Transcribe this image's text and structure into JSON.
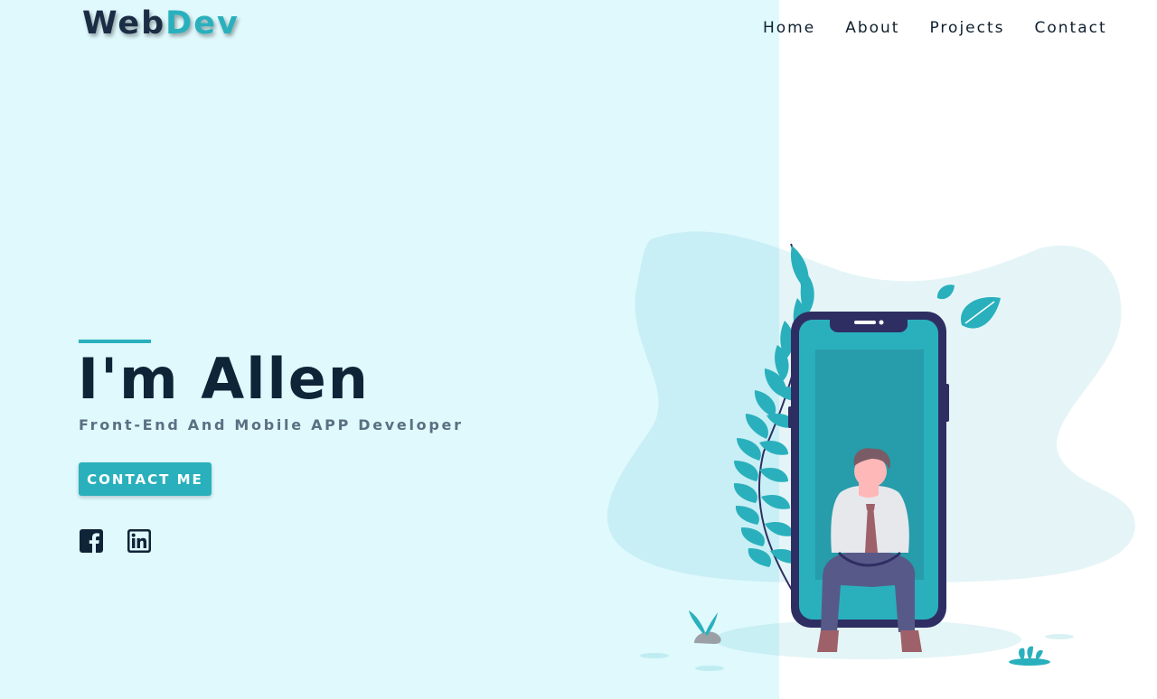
{
  "logo": {
    "part1": "Web",
    "part2": "Dev"
  },
  "nav": {
    "items": [
      {
        "label": "Home"
      },
      {
        "label": "About"
      },
      {
        "label": "Projects"
      },
      {
        "label": "Contact"
      }
    ]
  },
  "hero": {
    "title": "I'm Allen",
    "subtitle": "Front-End And Mobile APP Developer",
    "button_label": "CONTACT ME"
  },
  "social": {
    "icons": [
      "facebook-icon",
      "linkedin-icon"
    ]
  },
  "colors": {
    "accent": "#2ab0bd",
    "dark": "#0f2437",
    "background_left": "#dff9fd",
    "muted_text": "#5c6f82",
    "phone_frame": "#2f2e63"
  }
}
